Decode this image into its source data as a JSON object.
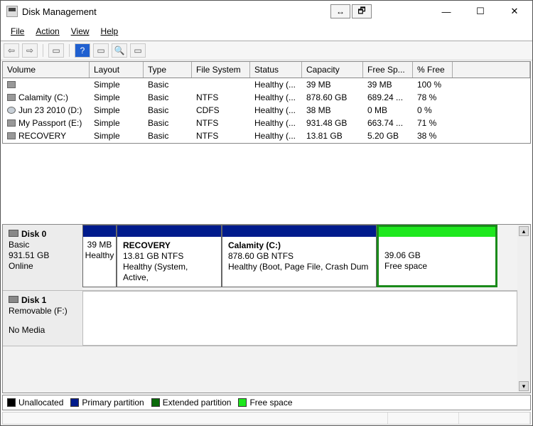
{
  "title": "Disk Management",
  "menu": [
    "File",
    "Action",
    "View",
    "Help"
  ],
  "midBtns": [
    "↔",
    "🗗"
  ],
  "winBtns": [
    "—",
    "☐",
    "✕"
  ],
  "columns": [
    "Volume",
    "Layout",
    "Type",
    "File System",
    "Status",
    "Capacity",
    "Free Sp...",
    "% Free"
  ],
  "rows": [
    {
      "icon": "hd",
      "name": "",
      "layout": "Simple",
      "type": "Basic",
      "fs": "",
      "status": "Healthy (...",
      "cap": "39 MB",
      "free": "39 MB",
      "pct": "100 %"
    },
    {
      "icon": "hd",
      "name": "Calamity (C:)",
      "layout": "Simple",
      "type": "Basic",
      "fs": "NTFS",
      "status": "Healthy (...",
      "cap": "878.60 GB",
      "free": "689.24 ...",
      "pct": "78 %"
    },
    {
      "icon": "cd",
      "name": "Jun 23 2010 (D:)",
      "layout": "Simple",
      "type": "Basic",
      "fs": "CDFS",
      "status": "Healthy (...",
      "cap": "38 MB",
      "free": "0 MB",
      "pct": "0 %"
    },
    {
      "icon": "hd",
      "name": "My Passport (E:)",
      "layout": "Simple",
      "type": "Basic",
      "fs": "NTFS",
      "status": "Healthy (...",
      "cap": "931.48 GB",
      "free": "663.74 ...",
      "pct": "71 %"
    },
    {
      "icon": "hd",
      "name": "RECOVERY",
      "layout": "Simple",
      "type": "Basic",
      "fs": "NTFS",
      "status": "Healthy (...",
      "cap": "13.81 GB",
      "free": "5.20 GB",
      "pct": "38 %"
    }
  ],
  "disk0": {
    "name": "Disk 0",
    "type": "Basic",
    "size": "931.51 GB",
    "state": "Online",
    "partitions": {
      "sys": {
        "size": "39 MB",
        "status": "Healthy"
      },
      "rec": {
        "name": "RECOVERY",
        "detail": "13.81 GB NTFS",
        "status": "Healthy (System, Active,"
      },
      "cal": {
        "name": "Calamity  (C:)",
        "detail": "878.60 GB NTFS",
        "status": "Healthy (Boot, Page File, Crash Dum"
      },
      "free": {
        "size": "39.06 GB",
        "label": "Free space"
      }
    }
  },
  "disk1": {
    "name": "Disk 1",
    "type": "Removable (F:)",
    "state": "No Media"
  },
  "legend": [
    {
      "color": "#000000",
      "label": "Unallocated"
    },
    {
      "color": "#001b8c",
      "label": "Primary partition"
    },
    {
      "color": "#0a6a0a",
      "label": "Extended partition"
    },
    {
      "color": "#1ee81e",
      "label": "Free space"
    }
  ]
}
